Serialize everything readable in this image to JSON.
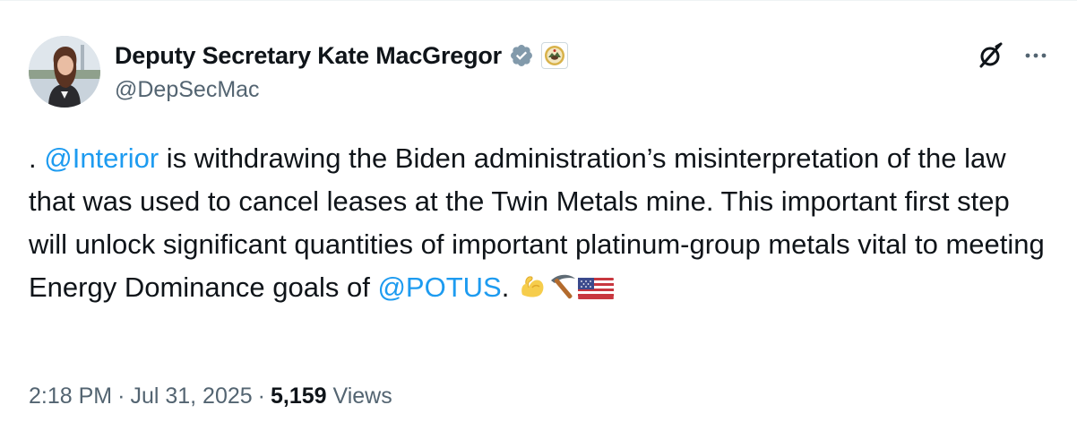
{
  "author": {
    "display_name": "Deputy Secretary Kate MacGregor",
    "handle": "@DepSecMac",
    "verified_icon": "verified-badge-icon",
    "affiliation_icon": "interior-seal-icon"
  },
  "actions": {
    "grok_icon": "grok-slash-icon",
    "more_icon": "more-horizontal-icon"
  },
  "tweet": {
    "prefix": ". ",
    "mention_interior": "@Interior",
    "body": " is withdrawing the Biden administration’s misinterpretation of the law that was used to cancel leases at the Twin Metals mine. This important first step will unlock significant quantities of important platinum-group metals vital to meeting Energy Dominance goals of ",
    "mention_potus": "@POTUS",
    "suffix": ". ",
    "emojis": [
      "flexed-biceps-icon",
      "pick-icon",
      "us-flag-icon"
    ]
  },
  "meta": {
    "time": "2:18 PM",
    "date": "Jul 31, 2025",
    "views_count": "5,159",
    "views_label": "Views"
  },
  "colors": {
    "link": "#1d9bf0",
    "secondary_text": "#536471",
    "primary_text": "#0f1419",
    "verified": "#829aab"
  }
}
